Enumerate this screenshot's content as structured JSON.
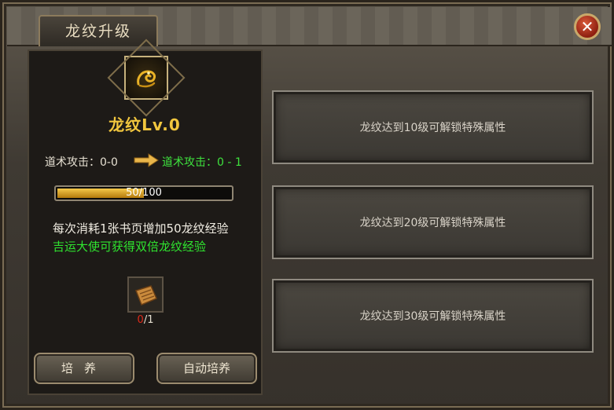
{
  "window": {
    "title": "龙纹升级",
    "close_label": "✕"
  },
  "dragon": {
    "level_label": "龙纹Lv.0",
    "icon": "dragon-emblem-icon"
  },
  "attribute": {
    "current": "道术攻击：0-0",
    "next": "道术攻击：0 - 1"
  },
  "progress": {
    "text": "50/100",
    "current": 50,
    "max": 100
  },
  "description": {
    "line1": "每次消耗1张书页增加50龙纹经验",
    "line2": "吉运大使可获得双倍龙纹经验"
  },
  "item": {
    "icon": "book-page-icon",
    "have": "0",
    "need": "/1"
  },
  "buttons": {
    "cultivate": "培养",
    "auto_cultivate": "自动培养"
  },
  "unlock_slots": [
    {
      "text": "龙纹达到10级可解锁特殊属性"
    },
    {
      "text": "龙纹达到20级可解锁特殊属性"
    },
    {
      "text": "龙纹达到30级可解锁特殊属性"
    }
  ],
  "colors": {
    "gold": "#f1c63e",
    "green": "#3ee23e",
    "red": "#e02a1a"
  }
}
